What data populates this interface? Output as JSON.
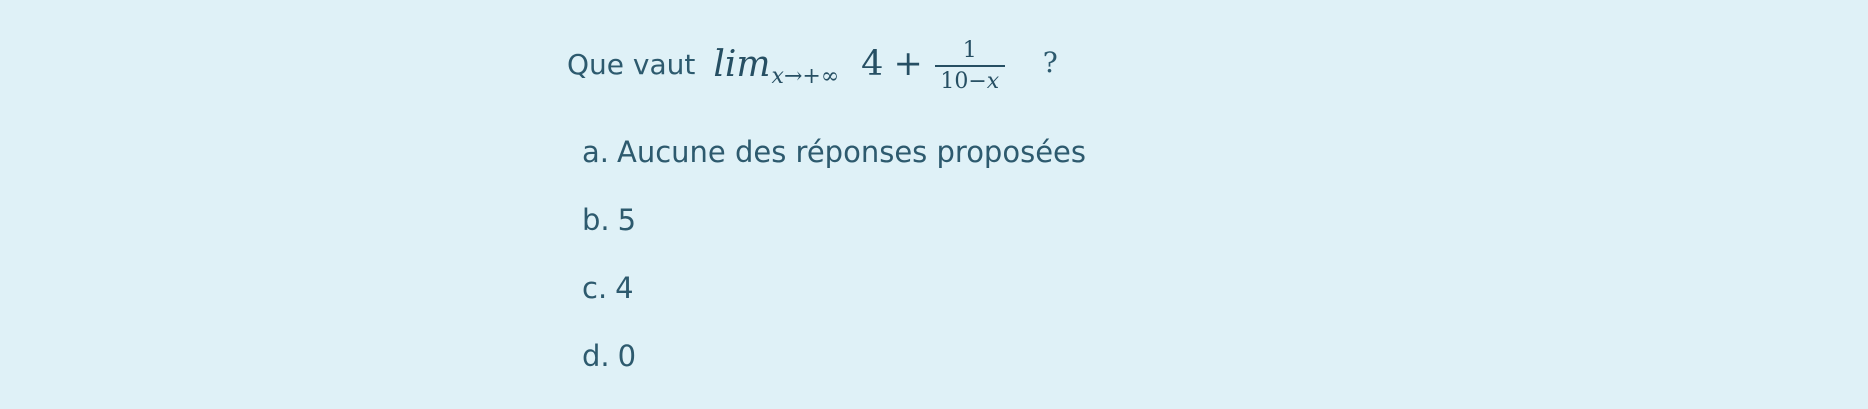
{
  "question": {
    "prefix": "Que vaut",
    "math": {
      "lim": "lim",
      "subscript": "x→+∞",
      "constant": "4",
      "plus": "+",
      "numerator": "1",
      "denominator_number": "10−",
      "denominator_variable": "x"
    },
    "suffix": "?"
  },
  "choices": [
    {
      "letter": "a.",
      "text": "Aucune des réponses proposées"
    },
    {
      "letter": "b.",
      "text": "5"
    },
    {
      "letter": "c.",
      "text": "4"
    },
    {
      "letter": "d.",
      "text": "0"
    }
  ],
  "colors": {
    "background": "#dff1f7",
    "text": "#2d5a6e"
  }
}
